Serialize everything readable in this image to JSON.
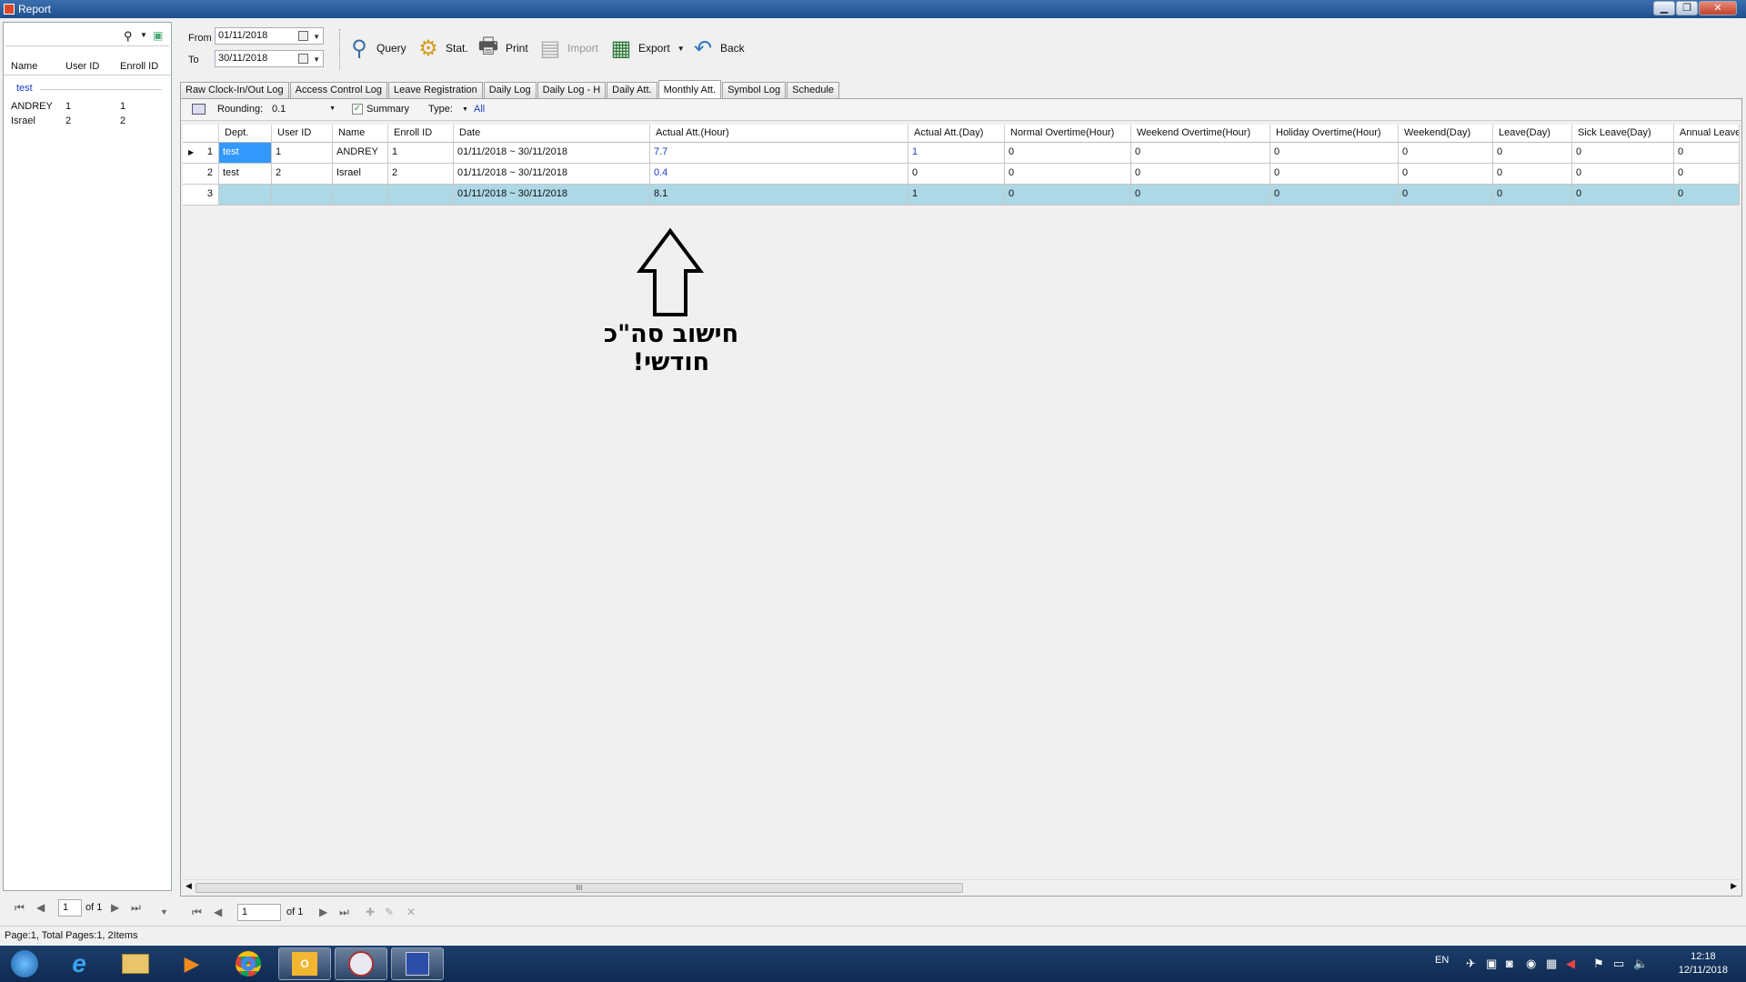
{
  "window": {
    "title": "Report",
    "minimize": "▁",
    "maximize": "❐",
    "close": "✕"
  },
  "left_panel": {
    "columns": [
      "Name",
      "User ID",
      "Enroll ID"
    ],
    "group": "test",
    "rows": [
      {
        "name": "ANDREY",
        "user_id": "1",
        "enroll_id": "1"
      },
      {
        "name": "Israel",
        "user_id": "2",
        "enroll_id": "2"
      }
    ],
    "pager": {
      "page": "1",
      "of": "of 1"
    }
  },
  "toolbar": {
    "from_label": "From",
    "from_value": "01/11/2018",
    "to_label": "To",
    "to_value": "30/11/2018",
    "query": "Query",
    "stat": "Stat.",
    "print": "Print",
    "import": "Import",
    "export": "Export",
    "back": "Back"
  },
  "tabs": [
    "Raw Clock-In/Out Log",
    "Access Control Log",
    "Leave Registration",
    "Daily Log",
    "Daily Log - H",
    "Daily Att.",
    "Monthly Att.",
    "Symbol Log",
    "Schedule"
  ],
  "active_tab": "Monthly Att.",
  "filter": {
    "rounding_label": "Rounding:",
    "rounding_value": "0.1",
    "summary_label": "Summary",
    "type_label": "Type:",
    "type_value": "All"
  },
  "grid": {
    "columns": [
      "Dept.",
      "User ID",
      "Name",
      "Enroll ID",
      "Date",
      "Actual Att.(Hour)",
      "Actual Att.(Day)",
      "Normal Overtime(Hour)",
      "Weekend Overtime(Hour)",
      "Holiday Overtime(Hour)",
      "Weekend(Day)",
      "Leave(Day)",
      "Sick Leave(Day)",
      "Annual Leave("
    ],
    "rows": [
      {
        "n": "1",
        "cells": [
          "test",
          "1",
          "ANDREY",
          "1",
          "01/11/2018 ~ 30/11/2018",
          "7.7",
          "1",
          "0",
          "0",
          "0",
          "0",
          "0",
          "0",
          "0"
        ]
      },
      {
        "n": "2",
        "cells": [
          "test",
          "2",
          "Israel",
          "2",
          "01/11/2018 ~ 30/11/2018",
          "0.4",
          "0",
          "0",
          "0",
          "0",
          "0",
          "0",
          "0",
          "0"
        ]
      },
      {
        "n": "3",
        "cells": [
          "",
          "",
          "",
          "",
          "01/11/2018 ~ 30/11/2018",
          "8.1",
          "1",
          "0",
          "0",
          "0",
          "0",
          "0",
          "0",
          "0"
        ]
      }
    ],
    "scroll_thumb": "III"
  },
  "pager": {
    "page": "1",
    "of": "of 1"
  },
  "annotation": "חישוב סה\"כ חודשי!",
  "status": "Page:1, Total Pages:1, 2Items",
  "taskbar": {
    "lang": "EN",
    "time": "12:18",
    "date": "12/11/2018"
  },
  "colors": {
    "selection": "#3399ff",
    "summary_row": "#add8e6",
    "link_blue": "#1b3fbf"
  }
}
